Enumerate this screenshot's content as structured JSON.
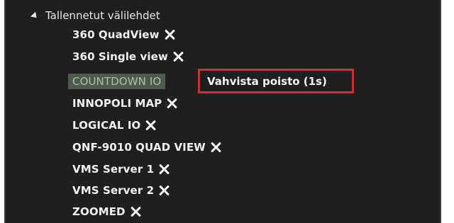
{
  "group": {
    "label": "Tallennetut välilehdet"
  },
  "items": [
    {
      "label": "360 QuadView"
    },
    {
      "label": "360 Single view"
    },
    {
      "label": "COUNTDOWN IO"
    },
    {
      "label": "INNOPOLI MAP"
    },
    {
      "label": "LOGICAL IO"
    },
    {
      "label": "QNF-9010 QUAD VIEW"
    },
    {
      "label": "VMS Server 1"
    },
    {
      "label": "VMS Server 2"
    },
    {
      "label": "ZOOMED"
    }
  ],
  "confirm_delete": {
    "label": "Vahvista poisto (1s)",
    "highlight_color": "#e0262b"
  },
  "icons": {
    "remove": "close-x-icon",
    "expand": "expanded-triangle-icon"
  }
}
